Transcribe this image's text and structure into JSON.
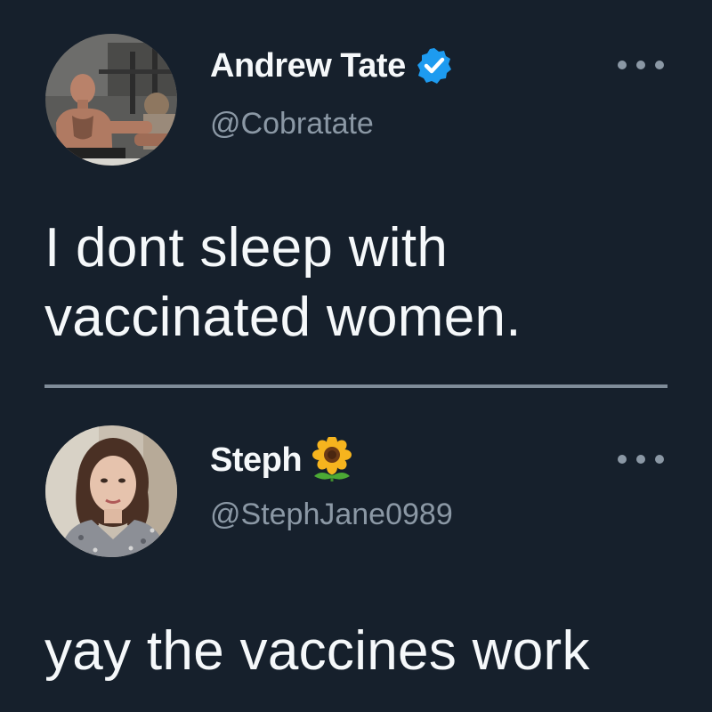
{
  "tweets": [
    {
      "display_name": "Andrew Tate",
      "handle": "@Cobratate",
      "verified": true,
      "badge_icon": "verified-badge-icon",
      "text": "I dont sleep with vaccinated women."
    },
    {
      "display_name": "Steph",
      "handle": "@StephJane0989",
      "name_emoji_icon": "sunflower-icon",
      "text": "yay the vaccines work"
    }
  ],
  "colors": {
    "background": "#16202c",
    "primary_text": "#f5f8fa",
    "secondary_text": "#8b98a5",
    "verified_blue": "#1d9bf0"
  }
}
